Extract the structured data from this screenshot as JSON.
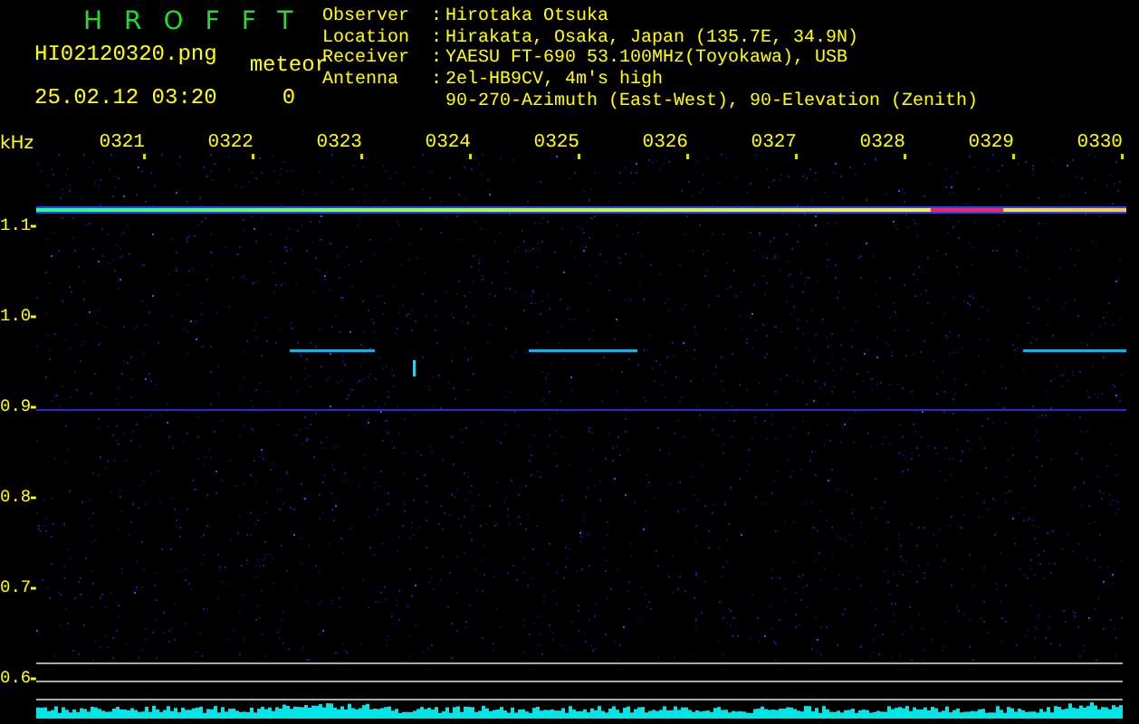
{
  "header": {
    "title": "HROFFT",
    "filename": "HI02120320.png",
    "timestamp": "25.02.12 03:20",
    "counter_label": "meteor",
    "counter_value": "0"
  },
  "station": [
    {
      "label": "Observer",
      "separator": ":",
      "value": "Hirotaka Otsuka"
    },
    {
      "label": "Location",
      "separator": ":",
      "value": "Hirakata, Osaka, Japan (135.7E, 34.9N)"
    },
    {
      "label": "Receiver",
      "separator": ":",
      "value": "YAESU FT-690 53.100MHz(Toyokawa), USB"
    },
    {
      "label": "Antenna",
      "separator": ":",
      "value": "2el-HB9CV, 4m's high"
    },
    {
      "value": "90-270-Azimuth (East-West), 90-Elevation (Zenith)"
    }
  ],
  "spectrogram": {
    "unit": "kHz",
    "time_labels": [
      "0321",
      "0322",
      "0323",
      "0324",
      "0325",
      "0326",
      "0327",
      "0328",
      "0329",
      "0330"
    ],
    "frequency_labels": [
      "1.1",
      "1.0",
      "0.9",
      "0.8",
      "0.7",
      "0.6"
    ]
  }
}
